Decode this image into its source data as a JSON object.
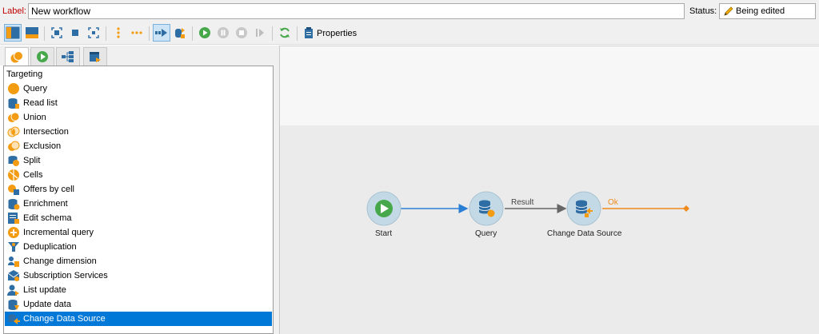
{
  "header": {
    "label_caption": "Label:",
    "label_value": "New workflow",
    "status_caption": "Status:",
    "status_value": "Being edited"
  },
  "toolbar": {
    "properties_label": "Properties",
    "icons": [
      "layout-vertical-icon",
      "layout-horizontal-icon",
      "zoom-fit-icon",
      "zoom-normal-icon",
      "zoom-selection-icon",
      "vertical-dots-icon",
      "horizontal-dots-icon",
      "run-mode-icon",
      "change-data-source-icon",
      "start-icon",
      "pause-icon",
      "stop-icon",
      "step-icon",
      "refresh-icon",
      "properties-icon"
    ]
  },
  "tabs": [
    "targeting-tab",
    "flow-control-tab",
    "actions-tab",
    "events-tab"
  ],
  "activity_list": {
    "header": "Targeting",
    "items": [
      {
        "label": "Query",
        "icon": "query-icon"
      },
      {
        "label": "Read list",
        "icon": "read-list-icon"
      },
      {
        "label": "Union",
        "icon": "union-icon"
      },
      {
        "label": "Intersection",
        "icon": "intersection-icon"
      },
      {
        "label": "Exclusion",
        "icon": "exclusion-icon"
      },
      {
        "label": "Split",
        "icon": "split-icon"
      },
      {
        "label": "Cells",
        "icon": "cells-icon"
      },
      {
        "label": "Offers by cell",
        "icon": "offers-by-cell-icon"
      },
      {
        "label": "Enrichment",
        "icon": "enrichment-icon"
      },
      {
        "label": "Edit schema",
        "icon": "edit-schema-icon"
      },
      {
        "label": "Incremental query",
        "icon": "incremental-query-icon"
      },
      {
        "label": "Deduplication",
        "icon": "deduplication-icon"
      },
      {
        "label": "Change dimension",
        "icon": "change-dimension-icon"
      },
      {
        "label": "Subscription Services",
        "icon": "subscription-services-icon"
      },
      {
        "label": "List update",
        "icon": "list-update-icon"
      },
      {
        "label": "Update data",
        "icon": "update-data-icon"
      },
      {
        "label": "Change Data Source",
        "icon": "change-data-source-icon",
        "selected": true
      }
    ]
  },
  "workflow": {
    "nodes": [
      {
        "label": "Start",
        "icon": "start-icon"
      },
      {
        "label": "Query",
        "icon": "query-icon"
      },
      {
        "label": "Change Data Source",
        "icon": "change-data-source-icon"
      }
    ],
    "transitions": [
      {
        "label": "",
        "color": "#2a7fd4"
      },
      {
        "label": "Result",
        "color": "#666666"
      },
      {
        "label": "Ok",
        "color": "#f08a1c"
      }
    ]
  },
  "colors": {
    "accent": "#0078d7",
    "orange": "#f39c12",
    "label_red": "#c00000",
    "green": "#46a84a"
  }
}
